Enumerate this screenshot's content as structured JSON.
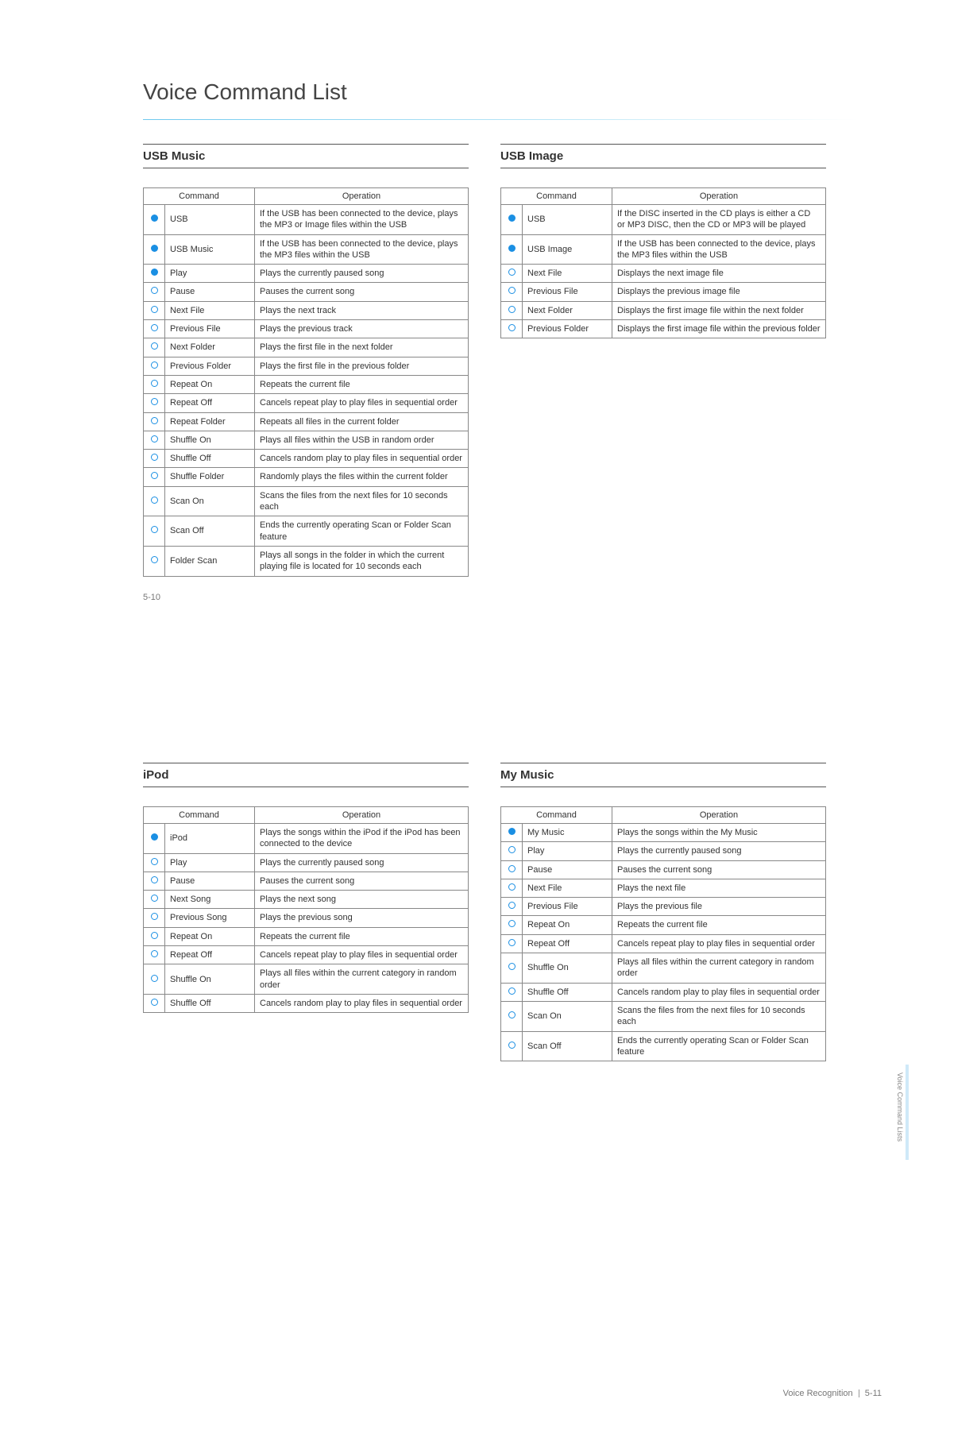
{
  "doc": {
    "title": "Voice Command List",
    "page_left": "5-10",
    "footer_right_label": "Voice Recognition",
    "footer_right_page": "5-11",
    "side_tab": "Voice Command Lists",
    "headers": {
      "command": "Command",
      "operation": "Operation"
    }
  },
  "sections": {
    "usb_music": {
      "title": "USB Music",
      "rows": [
        {
          "icon": "filled",
          "cmd": "USB",
          "op": "If the USB has been connected to the device, plays the MP3 or Image files within the USB"
        },
        {
          "icon": "filled",
          "cmd": "USB Music",
          "op": "If the USB has been connected to the device, plays the MP3 files within the USB"
        },
        {
          "icon": "filled",
          "cmd": "Play",
          "op": "Plays the currently paused song"
        },
        {
          "icon": "open",
          "cmd": "Pause",
          "op": "Pauses the current song"
        },
        {
          "icon": "open",
          "cmd": "Next File",
          "op": "Plays the next track"
        },
        {
          "icon": "open",
          "cmd": "Previous File",
          "op": "Plays the previous track"
        },
        {
          "icon": "open",
          "cmd": "Next Folder",
          "op": "Plays the first file in the next folder"
        },
        {
          "icon": "open",
          "cmd": "Previous Folder",
          "op": "Plays the first file in the  previous folder"
        },
        {
          "icon": "open",
          "cmd": "Repeat On",
          "op": "Repeats the current file"
        },
        {
          "icon": "open",
          "cmd": "Repeat Off",
          "op": "Cancels repeat play to play files in sequential order"
        },
        {
          "icon": "open",
          "cmd": "Repeat Folder",
          "op": "Repeats all files in the current folder"
        },
        {
          "icon": "open",
          "cmd": "Shuffle On",
          "op": "Plays all files within the USB in random order"
        },
        {
          "icon": "open",
          "cmd": "Shuffle Off",
          "op": "Cancels random play to play files in sequential order"
        },
        {
          "icon": "open",
          "cmd": "Shuffle Folder",
          "op": "Randomly plays the files within the current folder"
        },
        {
          "icon": "open",
          "cmd": "Scan On",
          "op": "Scans the files from the next files for 10 seconds each"
        },
        {
          "icon": "open",
          "cmd": "Scan Off",
          "op": "Ends the currently operating Scan or Folder Scan feature"
        },
        {
          "icon": "open",
          "cmd": "Folder Scan",
          "op": "Plays all songs in the folder in which the current playing file is located for 10 seconds each"
        }
      ]
    },
    "usb_image": {
      "title": "USB Image",
      "rows": [
        {
          "icon": "filled",
          "cmd": "USB",
          "op": "If the DISC inserted in the CD plays is either a CD or MP3 DISC, then the CD or MP3 will be played"
        },
        {
          "icon": "filled",
          "cmd": "USB Image",
          "op": "If the USB has been connected to the device, plays the MP3 files within the USB"
        },
        {
          "icon": "open",
          "cmd": "Next File",
          "op": "Displays the next image file"
        },
        {
          "icon": "open",
          "cmd": "Previous File",
          "op": "Displays the previous image file"
        },
        {
          "icon": "open",
          "cmd": "Next Folder",
          "op": "Displays the first image file within the next folder"
        },
        {
          "icon": "open",
          "cmd": "Previous Folder",
          "op": "Displays the first image file within the previous folder"
        }
      ]
    },
    "ipod": {
      "title": "iPod",
      "rows": [
        {
          "icon": "filled",
          "cmd": "iPod",
          "op": "Plays the songs within the iPod if the iPod has been connected to the device"
        },
        {
          "icon": "open",
          "cmd": "Play",
          "op": "Plays the currently paused song"
        },
        {
          "icon": "open",
          "cmd": "Pause",
          "op": "Pauses the current song"
        },
        {
          "icon": "open",
          "cmd": "Next Song",
          "op": "Plays the next song"
        },
        {
          "icon": "open",
          "cmd": "Previous Song",
          "op": "Plays the previous song"
        },
        {
          "icon": "open",
          "cmd": "Repeat On",
          "op": "Repeats the current file"
        },
        {
          "icon": "open",
          "cmd": "Repeat Off",
          "op": "Cancels repeat play to play files in sequential order"
        },
        {
          "icon": "open",
          "cmd": "Shuffle On",
          "op": "Plays all files within the current category in random order"
        },
        {
          "icon": "open",
          "cmd": "Shuffle Off",
          "op": "Cancels random play to play files in sequential order"
        }
      ]
    },
    "my_music": {
      "title": "My Music",
      "rows": [
        {
          "icon": "filled",
          "cmd": "My Music",
          "op": "Plays the songs within the My Music"
        },
        {
          "icon": "open",
          "cmd": "Play",
          "op": "Plays the currently paused song"
        },
        {
          "icon": "open",
          "cmd": "Pause",
          "op": "Pauses the current song"
        },
        {
          "icon": "open",
          "cmd": "Next File",
          "op": "Plays the next file"
        },
        {
          "icon": "open",
          "cmd": "Previous File",
          "op": "Plays the previous file"
        },
        {
          "icon": "open",
          "cmd": "Repeat On",
          "op": "Repeats the current file"
        },
        {
          "icon": "open",
          "cmd": "Repeat Off",
          "op": "Cancels repeat play to play files in sequential order"
        },
        {
          "icon": "open",
          "cmd": "Shuffle On",
          "op": "Plays all files within the current category in random order"
        },
        {
          "icon": "open",
          "cmd": "Shuffle Off",
          "op": "Cancels random play to play files in sequential order"
        },
        {
          "icon": "open",
          "cmd": "Scan On",
          "op": "Scans the files from the next files for 10 seconds each"
        },
        {
          "icon": "open",
          "cmd": "Scan Off",
          "op": "Ends the currently operating Scan or Folder Scan feature"
        }
      ]
    }
  }
}
